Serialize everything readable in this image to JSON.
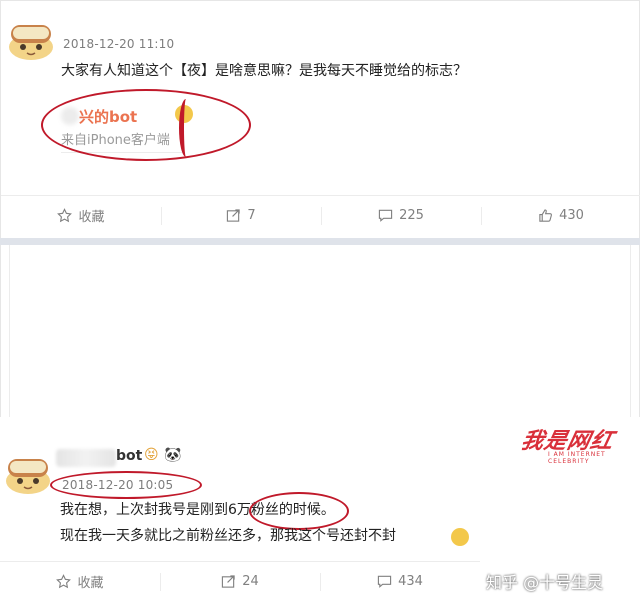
{
  "post1": {
    "timestamp": "2018-12-20 11:10",
    "text": "大家有人知道这个【夜】是啥意思嘛？是我每天不睡觉给的标志？",
    "repost_name": "兴的bot",
    "repost_source": "来自iPhone客户端",
    "actions": {
      "favorite": "收藏",
      "repost_count": "7",
      "comment_count": "225",
      "like_count": "430"
    }
  },
  "post2": {
    "username_tail": "bot",
    "timestamp": "2018-12-20 10:05",
    "line1": "我在想，上次封我号是刚到6万粉丝的时候。",
    "line2": "现在我一天多就比之前粉丝还多，那我这个号还封不封",
    "actions": {
      "favorite": "收藏",
      "repost_count": "24",
      "comment_count": "434"
    }
  },
  "watermark": {
    "text": "我是网红",
    "sub": "I AM INTERNET CELEBRITY"
  },
  "zhihu_mark": "知乎 @十号生灵",
  "colors": {
    "accent_orange": "#eb7350",
    "annotation_red": "#c0192a",
    "watermark_red": "#d9303a",
    "action_gray": "#808080"
  }
}
